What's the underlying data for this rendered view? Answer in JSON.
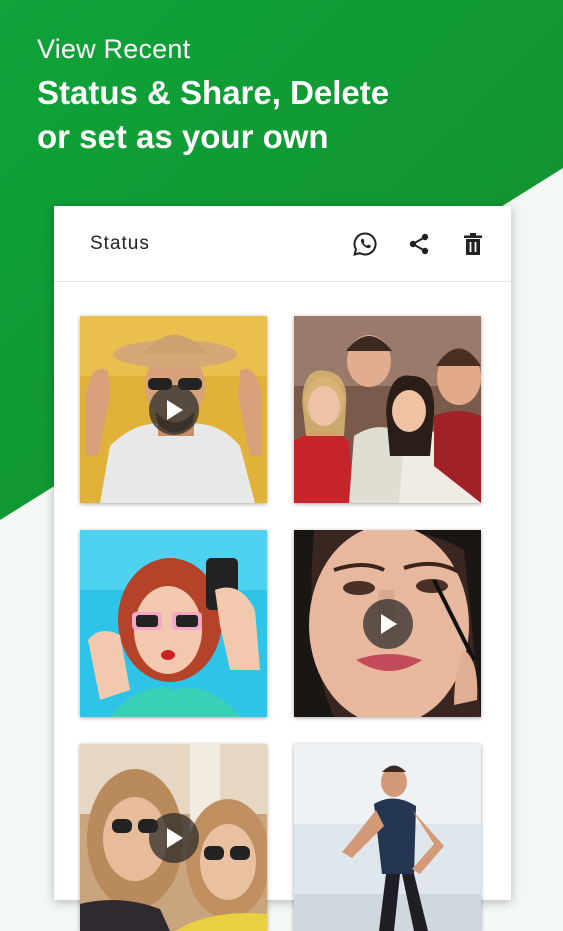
{
  "hero": {
    "subtitle": "View Recent",
    "headline": "Status & Share, Delete\nor set as your own"
  },
  "card": {
    "title": "Status",
    "actions": [
      {
        "name": "whatsapp-icon"
      },
      {
        "name": "share-icon"
      },
      {
        "name": "delete-icon"
      }
    ]
  },
  "tiles": [
    {
      "kind": "video",
      "subject": "man-with-hat-and-sunglasses"
    },
    {
      "kind": "image",
      "subject": "group-of-friends"
    },
    {
      "kind": "image",
      "subject": "woman-selfie-pink-sunglasses"
    },
    {
      "kind": "video",
      "subject": "woman-applying-mascara"
    },
    {
      "kind": "video",
      "subject": "two-women-sunglasses"
    },
    {
      "kind": "image",
      "subject": "man-running-beach"
    }
  ],
  "colors": {
    "brand_green": "#0fa33a",
    "background": "#f3f8f4",
    "card": "#ffffff"
  }
}
